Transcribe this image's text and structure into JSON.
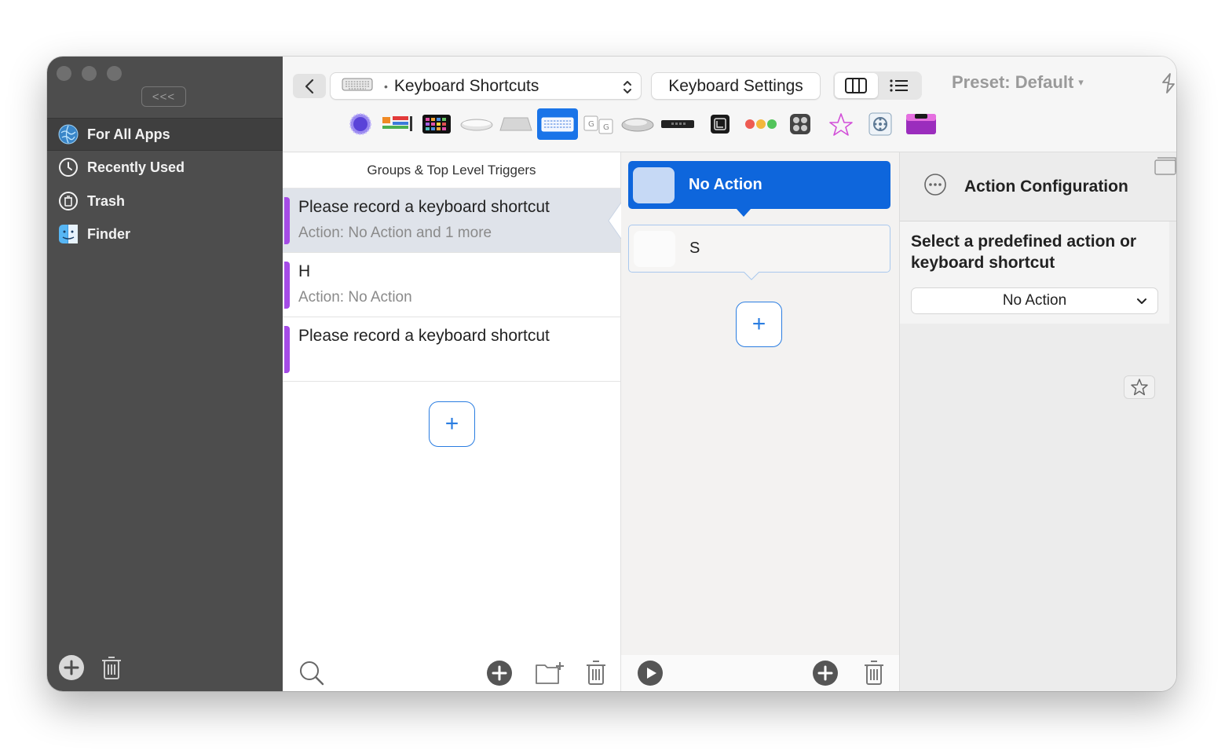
{
  "sidebar": {
    "collapse_label": "<<<",
    "items": [
      {
        "label": "For All Apps",
        "icon": "globe-icon"
      },
      {
        "label": "Recently Used",
        "icon": "clock-icon"
      },
      {
        "label": "Trash",
        "icon": "trash-icon"
      },
      {
        "label": "Finder",
        "icon": "finder-icon"
      }
    ]
  },
  "toolbar": {
    "category_dot": "•",
    "category_label": "Keyboard Shortcuts",
    "settings_label": "Keyboard Settings",
    "preset_label": "Preset: Default",
    "preset_caret": "▾",
    "devices": [
      "touchpad-icon",
      "touchbar-icon",
      "streamdeck-icon",
      "magic-mouse-icon",
      "magic-trackpad-icon",
      "keyboard-icon",
      "gesture-icon",
      "mouse-icon",
      "siri-remote-icon",
      "stream-deck-icon",
      "other-icon",
      "cheat-icon",
      "star-draw-icon",
      "midi-icon",
      "notch-bar-icon"
    ],
    "active_device": "keyboard-icon"
  },
  "triggers": {
    "header": "Groups & Top Level Triggers",
    "items": [
      {
        "title": "Please record a keyboard shortcut",
        "subtitle": "Action: No Action and 1 more"
      },
      {
        "title": "H",
        "subtitle": "Action: No Action"
      },
      {
        "title": "Please record a keyboard shortcut",
        "subtitle": ""
      }
    ],
    "add_label": "+"
  },
  "actions": {
    "items": [
      {
        "label": "No Action"
      },
      {
        "label": "S"
      }
    ],
    "add_label": "+"
  },
  "config": {
    "title": "Action Configuration",
    "prompt": "Select a predefined action or keyboard shortcut",
    "selected_action": "No Action"
  },
  "colors": {
    "accent": "#0e66dc",
    "sidebar_bg": "#4d4d4d",
    "trigger_bar": "#a54be6"
  }
}
